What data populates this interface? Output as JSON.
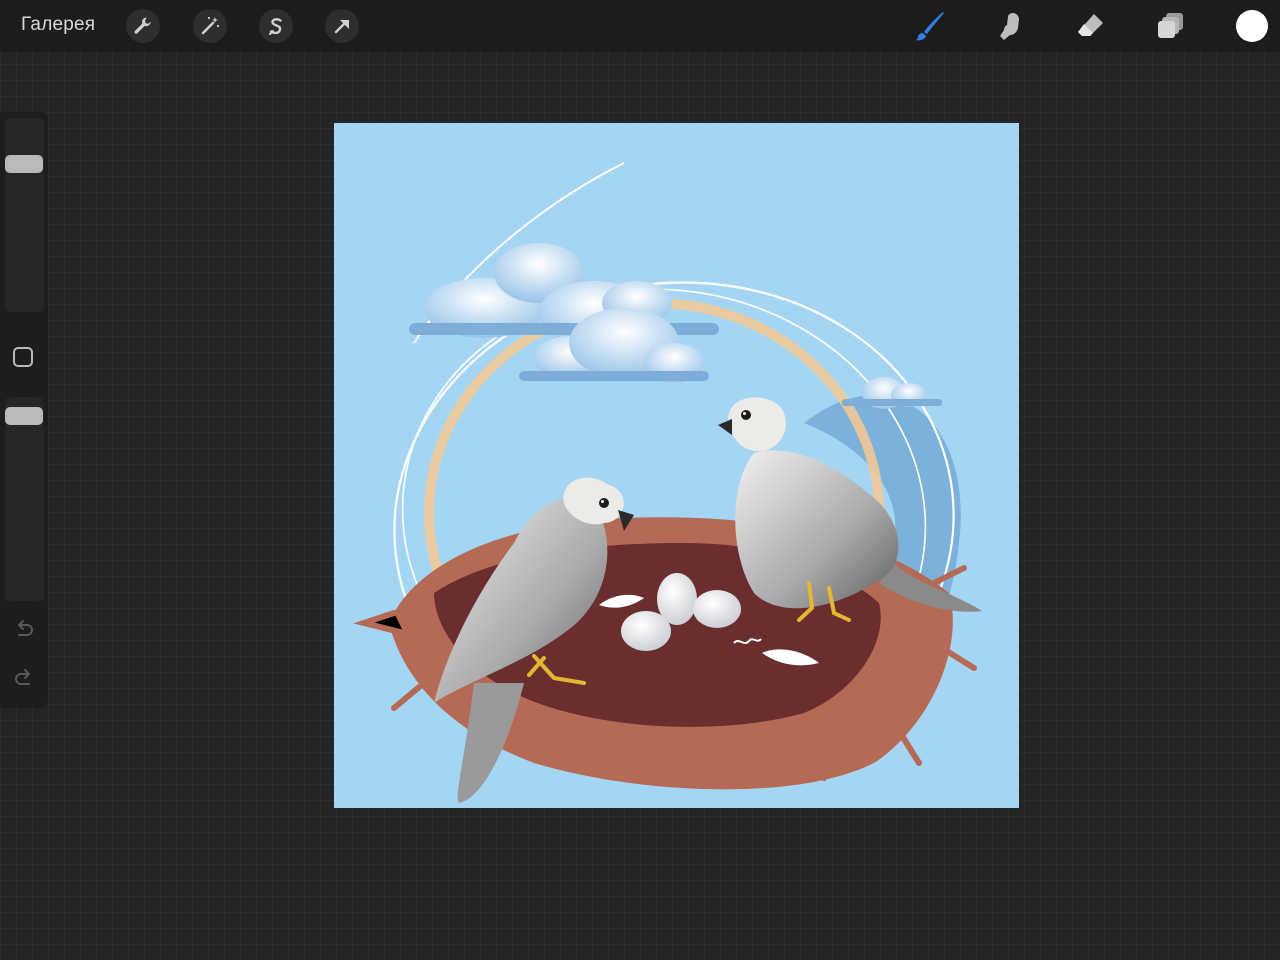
{
  "app": {
    "gallery_label": "Галерея"
  },
  "toolbar_left": [
    {
      "name": "actions-wrench",
      "icon": "wrench-icon"
    },
    {
      "name": "adjustments",
      "icon": "magic-wand-icon"
    },
    {
      "name": "selection",
      "icon": "selection-s-icon"
    },
    {
      "name": "transform",
      "icon": "arrow-cursor-icon"
    }
  ],
  "toolbar_right": [
    {
      "name": "brush",
      "icon": "brush-icon",
      "active": true,
      "color": "#2f7fe6"
    },
    {
      "name": "smudge",
      "icon": "smudge-finger-icon"
    },
    {
      "name": "eraser",
      "icon": "eraser-icon"
    },
    {
      "name": "layers",
      "icon": "layers-icon"
    }
  ],
  "current_color": "#ffffff",
  "sidebar": {
    "brush_size_level": 0.25,
    "opacity_level": 0.35,
    "modify_button_icon": "square-icon",
    "undo_icon": "undo-icon",
    "redo_icon": "redo-icon"
  },
  "artwork": {
    "description_icon": "falcons-nest-illustration",
    "background_color": "#a4d6f4"
  }
}
